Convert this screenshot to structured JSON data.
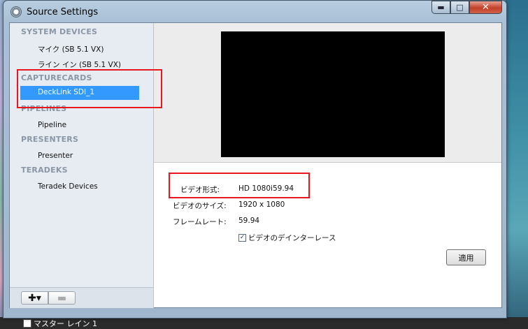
{
  "window": {
    "title": "Source Settings",
    "min_glyph": "▬",
    "max_glyph": "□",
    "close_glyph": "✕"
  },
  "sidebar": {
    "sections": [
      {
        "label": "SYSTEM DEVICES",
        "items": [
          "マイク (SB 5.1 VX)",
          "ライン イン (SB 5.1 VX)"
        ]
      },
      {
        "label": "CAPTURECARDS",
        "items": [
          "DeckLink SDI_1"
        ]
      },
      {
        "label": "PIPELINES",
        "items": [
          "Pipeline"
        ]
      },
      {
        "label": "PRESENTERS",
        "items": [
          "Presenter"
        ]
      },
      {
        "label": "TERADEKS",
        "items": [
          "Teradek Devices"
        ]
      }
    ],
    "selected": "DeckLink SDI_1",
    "add_label": "✚▾",
    "remove_label": "▬"
  },
  "properties": {
    "video_format_label": "ビデオ形式:",
    "video_format_value": "HD 1080i59.94",
    "video_size_label": "ビデオのサイズ:",
    "video_size_value": "1920 x 1080",
    "frame_rate_label": "フレームレート:",
    "frame_rate_value": "59.94",
    "deinterlace_label": "ビデオのデインターレース",
    "deinterlace_checked": true,
    "apply_label": "適用"
  },
  "background": {
    "checkbox_label": "マスター レイン 1"
  },
  "colors": {
    "selection": "#3399ff",
    "highlight": "#e8171f",
    "section": "#8a97a6"
  }
}
